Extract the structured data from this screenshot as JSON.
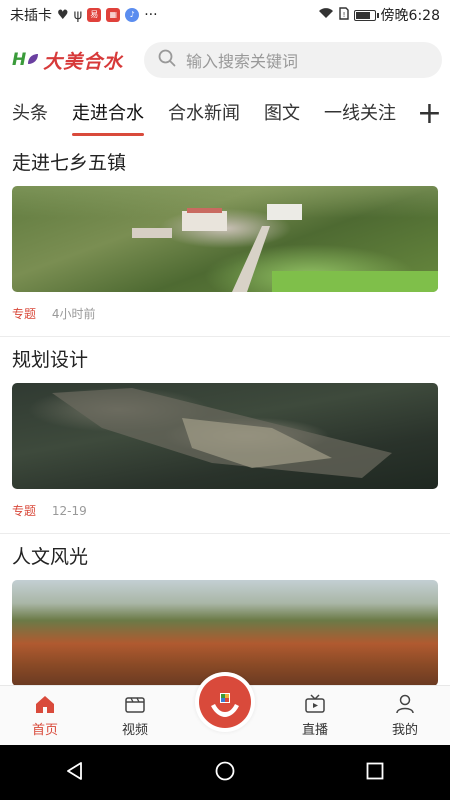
{
  "status_bar": {
    "carrier": "未插卡",
    "app_badge": "网易",
    "more": "···",
    "time_text": "傍晚6:28"
  },
  "header": {
    "logo_mark": "H",
    "logo_text": "大美合水",
    "search_placeholder": "输入搜索关键词"
  },
  "tabs": [
    {
      "label": "头条"
    },
    {
      "label": "走进合水"
    },
    {
      "label": "合水新闻"
    },
    {
      "label": "图文"
    },
    {
      "label": "一线关注"
    }
  ],
  "tab_plus": "+",
  "feed": [
    {
      "title": "走进七乡五镇",
      "tag": "专题",
      "time": "4小时前"
    },
    {
      "title": "规划设计",
      "tag": "专题",
      "time": "12-19"
    },
    {
      "title": "人文风光",
      "tag": "",
      "time": ""
    }
  ],
  "bottom_nav": [
    {
      "label": "首页",
      "icon": "home-icon"
    },
    {
      "label": "视频",
      "icon": "video-icon"
    },
    {
      "label": "直播",
      "icon": "tv-icon"
    },
    {
      "label": "我的",
      "icon": "user-icon"
    }
  ],
  "colors": {
    "accent": "#d94a3b",
    "search_bg": "#f1f1f1",
    "nav_bg": "#fafafa"
  }
}
